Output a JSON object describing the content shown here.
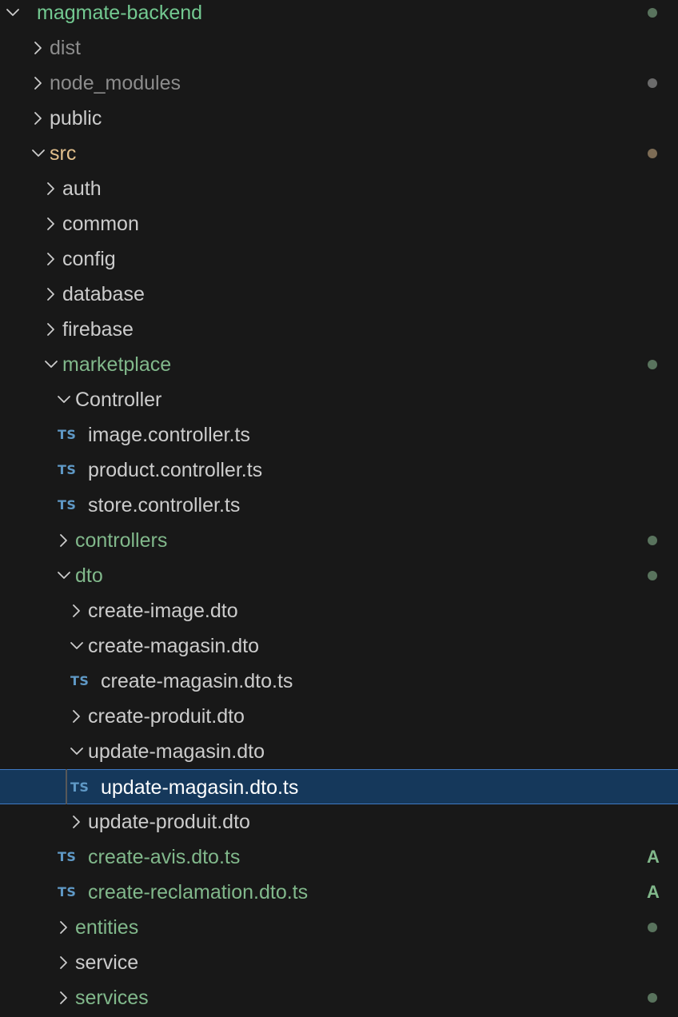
{
  "explorer": {
    "colors": {
      "text_default": "#cccccc",
      "text_ignored": "#8c8c8c",
      "text_untracked": "#73c991",
      "text_modified": "#e2c08d",
      "text_muted_green": "#81b88b",
      "ts_icon": "#5f99c6",
      "selection_bg": "#15385b",
      "selection_border": "#3f79c3",
      "dot_green": "#59735d",
      "dot_gray": "#6b6b6b",
      "dot_brown": "#7d6c55",
      "chevron": "#cccccc"
    },
    "items": [
      {
        "label": "magmate-backend",
        "depth": 0,
        "kind": "folder",
        "expanded": true,
        "color": "#73c991",
        "dot": "#59735d",
        "name": "folder-magmate-backend"
      },
      {
        "label": "dist",
        "depth": 1,
        "kind": "folder",
        "expanded": false,
        "color": "#8c8c8c",
        "name": "folder-dist"
      },
      {
        "label": "node_modules",
        "depth": 1,
        "kind": "folder",
        "expanded": false,
        "color": "#8c8c8c",
        "dot": "#6b6b6b",
        "name": "folder-node-modules"
      },
      {
        "label": "public",
        "depth": 1,
        "kind": "folder",
        "expanded": false,
        "color": "#cccccc",
        "name": "folder-public"
      },
      {
        "label": "src",
        "depth": 1,
        "kind": "folder",
        "expanded": true,
        "color": "#e2c08d",
        "dot": "#7d6c55",
        "name": "folder-src"
      },
      {
        "label": "auth",
        "depth": 2,
        "kind": "folder",
        "expanded": false,
        "color": "#cccccc",
        "name": "folder-auth"
      },
      {
        "label": "common",
        "depth": 2,
        "kind": "folder",
        "expanded": false,
        "color": "#cccccc",
        "name": "folder-common"
      },
      {
        "label": "config",
        "depth": 2,
        "kind": "folder",
        "expanded": false,
        "color": "#cccccc",
        "name": "folder-config"
      },
      {
        "label": "database",
        "depth": 2,
        "kind": "folder",
        "expanded": false,
        "color": "#cccccc",
        "name": "folder-database"
      },
      {
        "label": "firebase",
        "depth": 2,
        "kind": "folder",
        "expanded": false,
        "color": "#cccccc",
        "name": "folder-firebase"
      },
      {
        "label": "marketplace",
        "depth": 2,
        "kind": "folder",
        "expanded": true,
        "color": "#81b88b",
        "dot": "#59735d",
        "name": "folder-marketplace"
      },
      {
        "label": "Controller",
        "depth": 3,
        "kind": "folder",
        "expanded": true,
        "color": "#cccccc",
        "name": "folder-controller"
      },
      {
        "label": "image.controller.ts",
        "depth": 4,
        "kind": "ts",
        "color": "#cccccc",
        "name": "file-image-controller-ts"
      },
      {
        "label": "product.controller.ts",
        "depth": 4,
        "kind": "ts",
        "color": "#cccccc",
        "name": "file-product-controller-ts"
      },
      {
        "label": "store.controller.ts",
        "depth": 4,
        "kind": "ts",
        "color": "#cccccc",
        "name": "file-store-controller-ts"
      },
      {
        "label": "controllers",
        "depth": 3,
        "kind": "folder",
        "expanded": false,
        "color": "#81b88b",
        "dot": "#59735d",
        "name": "folder-controllers"
      },
      {
        "label": "dto",
        "depth": 3,
        "kind": "folder",
        "expanded": true,
        "color": "#81b88b",
        "dot": "#59735d",
        "name": "folder-dto"
      },
      {
        "label": "create-image.dto",
        "depth": 4,
        "kind": "folder",
        "expanded": false,
        "color": "#cccccc",
        "name": "folder-create-image-dto"
      },
      {
        "label": "create-magasin.dto",
        "depth": 4,
        "kind": "folder",
        "expanded": true,
        "color": "#cccccc",
        "name": "folder-create-magasin-dto"
      },
      {
        "label": "create-magasin.dto.ts",
        "depth": 5,
        "kind": "ts",
        "color": "#cccccc",
        "name": "file-create-magasin-dto-ts"
      },
      {
        "label": "create-produit.dto",
        "depth": 4,
        "kind": "folder",
        "expanded": false,
        "color": "#cccccc",
        "name": "folder-create-produit-dto"
      },
      {
        "label": "update-magasin.dto",
        "depth": 4,
        "kind": "folder",
        "expanded": true,
        "color": "#cccccc",
        "name": "folder-update-magasin-dto"
      },
      {
        "label": "update-magasin.dto.ts",
        "depth": 5,
        "kind": "ts",
        "color": "#ffffff",
        "selected": true,
        "name": "file-update-magasin-dto-ts"
      },
      {
        "label": "update-produit.dto",
        "depth": 4,
        "kind": "folder",
        "expanded": false,
        "color": "#cccccc",
        "name": "folder-update-produit-dto"
      },
      {
        "label": "create-avis.dto.ts",
        "depth": 4,
        "kind": "ts",
        "color": "#81b88b",
        "badge": "A",
        "name": "file-create-avis-dto-ts"
      },
      {
        "label": "create-reclamation.dto.ts",
        "depth": 4,
        "kind": "ts",
        "color": "#81b88b",
        "badge": "A",
        "name": "file-create-reclamation-dto-ts"
      },
      {
        "label": "entities",
        "depth": 3,
        "kind": "folder",
        "expanded": false,
        "color": "#81b88b",
        "dot": "#59735d",
        "name": "folder-entities"
      },
      {
        "label": "service",
        "depth": 3,
        "kind": "folder",
        "expanded": false,
        "color": "#cccccc",
        "name": "folder-service"
      },
      {
        "label": "services",
        "depth": 3,
        "kind": "folder",
        "expanded": false,
        "color": "#81b88b",
        "dot": "#59735d",
        "name": "folder-services"
      }
    ],
    "ts_icon_text": "TS"
  }
}
